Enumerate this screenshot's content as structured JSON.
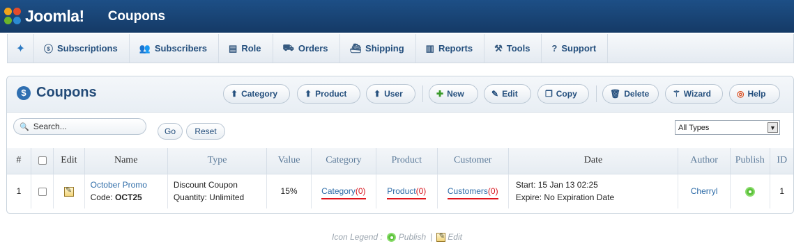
{
  "app": {
    "logo_text": "Joomla!",
    "page_title": "Coupons"
  },
  "menu": {
    "items": [
      {
        "label": "Subscriptions",
        "icon": "dollar-circle-icon"
      },
      {
        "label": "Subscribers",
        "icon": "users-icon"
      },
      {
        "label": "Role",
        "icon": "id-card-icon"
      },
      {
        "label": "Orders",
        "icon": "truck-icon"
      },
      {
        "label": "Shipping",
        "icon": "ship-icon"
      },
      {
        "label": "Reports",
        "icon": "bar-chart-icon"
      },
      {
        "label": "Tools",
        "icon": "tools-icon"
      },
      {
        "label": "Support",
        "icon": "question-icon"
      }
    ]
  },
  "panel": {
    "title": "Coupons",
    "toolbar": {
      "category": "Category",
      "product": "Product",
      "user": "User",
      "new": "New",
      "edit": "Edit",
      "copy": "Copy",
      "delete": "Delete",
      "wizard": "Wizard",
      "help": "Help"
    },
    "filter": {
      "search_placeholder": "Search...",
      "go": "Go",
      "reset": "Reset",
      "type_select": "All Types"
    }
  },
  "table": {
    "headers": {
      "num": "#",
      "edit": "Edit",
      "name": "Name",
      "type": "Type",
      "value": "Value",
      "category": "Category",
      "product": "Product",
      "customer": "Customer",
      "date": "Date",
      "author": "Author",
      "publish": "Publish",
      "id": "ID"
    },
    "rows": [
      {
        "num": "1",
        "name": "October Promo",
        "code_label": "Code:",
        "code": "OCT25",
        "type_line1": "Discount Coupon",
        "type_line2": "Quantity: Unlimited",
        "value": "15%",
        "category_link": "Category",
        "category_count": "(0)",
        "product_link": "Product",
        "product_count": "(0)",
        "customer_link": "Customers",
        "customer_count": "(0)",
        "date_start": "Start: 15 Jan 13 02:25",
        "date_expire": "Expire: No Expiration Date",
        "author": "Cherryl",
        "id": "1"
      }
    ]
  },
  "legend": {
    "label": "Icon Legend :",
    "publish": "Publish",
    "separator": "|",
    "edit": "Edit"
  },
  "colors": {
    "header_bg": "#1d4f86",
    "link": "#2e6ca8",
    "highlight": "#e0141c",
    "publish": "#5cc13b"
  }
}
